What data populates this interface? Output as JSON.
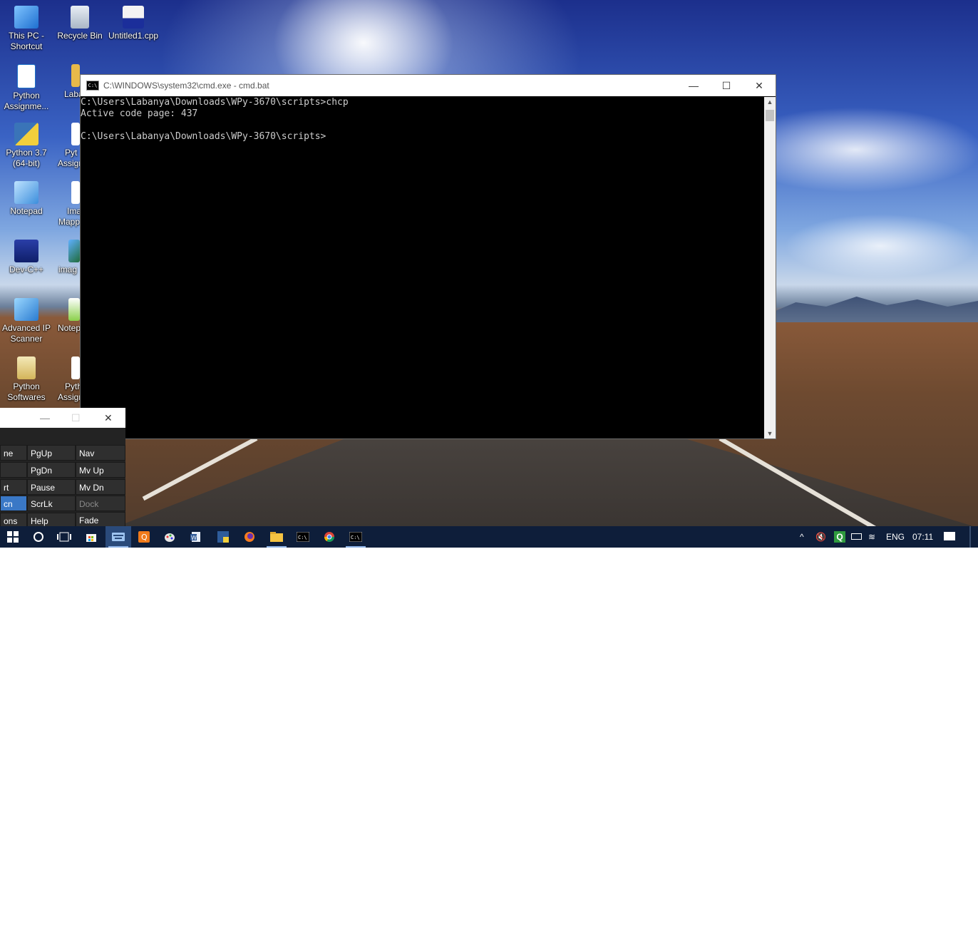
{
  "desktop_icons": [
    {
      "label_line1": "This PC -",
      "label_line2": "Shortcut"
    },
    {
      "label_line1": "Recycle Bin",
      "label_line2": ""
    },
    {
      "label_line1": "Untitled1.cpp",
      "label_line2": ""
    },
    {
      "label_line1": "Python",
      "label_line2": "Assignme..."
    },
    {
      "label_line1": "Laba",
      "label_line2": ""
    },
    {
      "label_line1": "Python 3.7",
      "label_line2": "(64-bit)"
    },
    {
      "label_line1": "Pyt",
      "label_line2": "Assign"
    },
    {
      "label_line1": "Notepad",
      "label_line2": ""
    },
    {
      "label_line1": "Ima",
      "label_line2": "Mapp"
    },
    {
      "label_line1": "Dev-C++",
      "label_line2": ""
    },
    {
      "label_line1": "imag",
      "label_line2": ""
    },
    {
      "label_line1": "Advanced IP",
      "label_line2": "Scanner"
    },
    {
      "label_line1": "Notep",
      "label_line2": ""
    },
    {
      "label_line1": "Python",
      "label_line2": "Softwares"
    },
    {
      "label_line1": "Pyth",
      "label_line2": "Assign"
    }
  ],
  "cmd_window": {
    "title": "C:\\WINDOWS\\system32\\cmd.exe - cmd.bat",
    "app_icon_text": "C:\\",
    "minimize": "—",
    "maximize": "☐",
    "close": "✕",
    "console_text": "C:\\Users\\Labanya\\Downloads\\WPy-3670\\scripts>chcp\nActive code page: 437\n\nC:\\Users\\Labanya\\Downloads\\WPy-3670\\scripts>"
  },
  "osk": {
    "minimize": "—",
    "maximize": "☐",
    "close": "✕",
    "keys": [
      [
        "ne",
        "PgUp",
        "Nav"
      ],
      [
        "",
        "PgDn",
        "Mv Up"
      ],
      [
        "rt",
        "Pause",
        "Mv Dn"
      ],
      [
        "cn",
        "ScrLk",
        "Dock"
      ],
      [
        "ons",
        "Help",
        "Fade"
      ]
    ]
  },
  "taskbar": {
    "language": "ENG",
    "time": "07:11"
  },
  "colors": {
    "taskbar": "#0e1e3a",
    "console_bg": "#000000",
    "console_fg": "#cccccc",
    "osk_selected": "#3a78c6"
  }
}
